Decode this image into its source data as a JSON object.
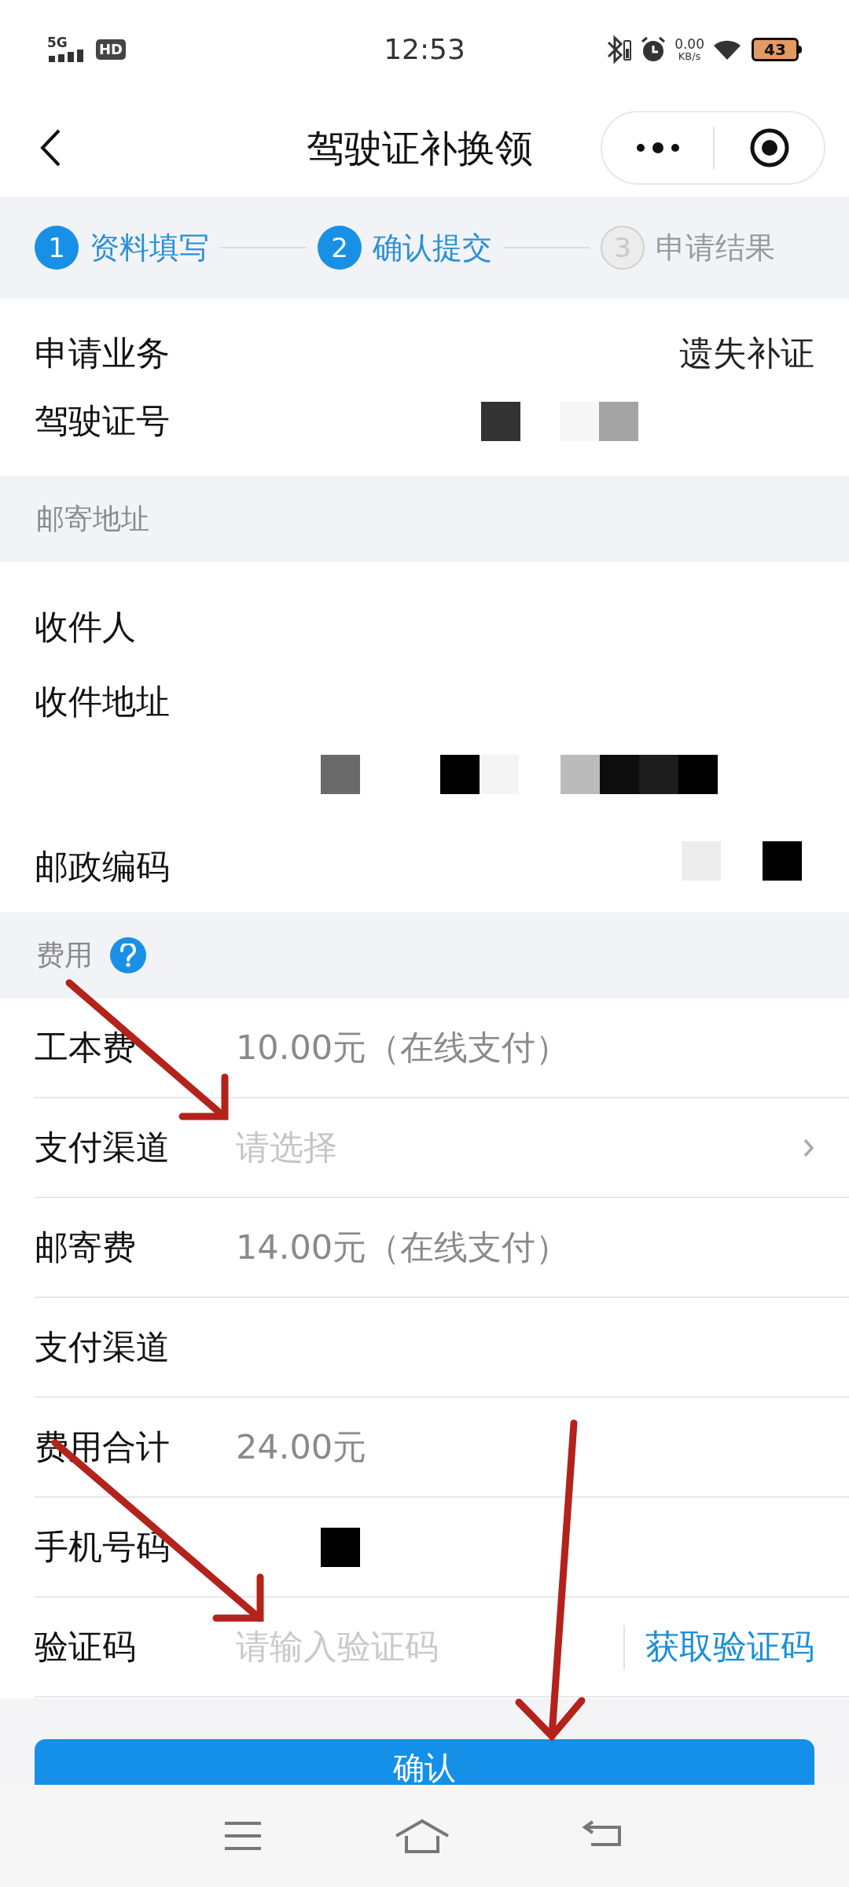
{
  "status_bar": {
    "network": "5G",
    "hd": "HD",
    "time": "12:53",
    "speed": "0.00",
    "speed_unit": "KB/s",
    "battery": "43"
  },
  "header": {
    "title": "驾驶证补换领"
  },
  "steps": [
    {
      "number": "1",
      "label": "资料填写",
      "active": true
    },
    {
      "number": "2",
      "label": "确认提交",
      "active": true
    },
    {
      "number": "3",
      "label": "申请结果",
      "active": false
    }
  ],
  "application": [
    {
      "label": "申请业务",
      "kind": "text",
      "value": "遗失补证"
    },
    {
      "label": "驾驶证号",
      "kind": "redacted"
    }
  ],
  "mailing": {
    "title": "邮寄地址",
    "rows": [
      {
        "label": "收件人",
        "kind": "empty"
      },
      {
        "label": "收件地址",
        "kind": "redacted"
      },
      {
        "label": "邮政编码",
        "kind": "redacted"
      }
    ]
  },
  "fees": {
    "title": "费用",
    "rows": [
      {
        "label": "工本费",
        "kind": "text",
        "value": "10.00元（在线支付）"
      },
      {
        "label": "支付渠道",
        "kind": "select",
        "placeholder": "请选择"
      },
      {
        "label": "邮寄费",
        "kind": "text",
        "value": "14.00元（在线支付）"
      },
      {
        "label": "支付渠道",
        "kind": "empty"
      },
      {
        "label": "费用合计",
        "kind": "text",
        "value": "24.00元"
      },
      {
        "label": "手机号码",
        "kind": "redacted"
      },
      {
        "label": "验证码",
        "kind": "code",
        "placeholder": "请输入验证码",
        "action": "获取验证码"
      }
    ]
  },
  "submit": {
    "label": "确认"
  }
}
